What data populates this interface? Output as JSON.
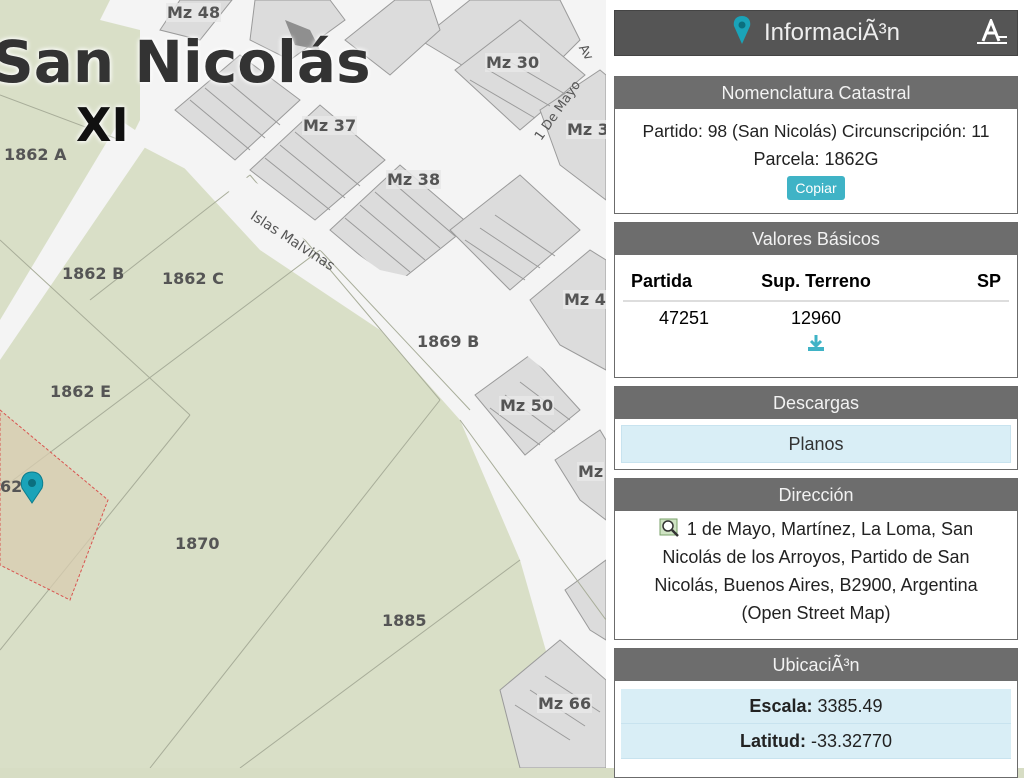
{
  "map": {
    "city_label": "San Nicolás",
    "district_label": "XI",
    "parcels": [
      "1862 A",
      "1862 B",
      "1862 C",
      "1862 E",
      "1869 B",
      "1870",
      "1885",
      "62"
    ],
    "blocks": [
      "Mz 48",
      "Mz 30",
      "Mz 37",
      "Mz 38",
      "Mz 3",
      "Mz 4",
      "Mz 50",
      "Mz",
      "Mz 66"
    ],
    "streets": [
      "Islas Malvinas",
      "1 De Mayo",
      "Av"
    ]
  },
  "panel": {
    "title": "InformaciÃ³n",
    "nomenclatura": {
      "header": "Nomenclatura Catastral",
      "line1": "Partido: 98 (San Nicolás) Circunscripción: 11",
      "line2": "Parcela: 1862G",
      "copy_label": "Copiar"
    },
    "valores": {
      "header": "Valores Básicos",
      "columns": [
        "Partida",
        "Sup. Terreno",
        "SP"
      ],
      "rows": [
        [
          "47251",
          "12960",
          ""
        ]
      ]
    },
    "descargas": {
      "header": "Descargas",
      "item": "Planos"
    },
    "direccion": {
      "header": "Dirección",
      "text": "1 de Mayo, Martínez, La Loma, San Nicolás de los Arroyos, Partido de San Nicolás, Buenos Aires, B2900, Argentina (Open Street Map)"
    },
    "ubicacion": {
      "header": "UbicaciÃ³n",
      "escala_label": "Escala:",
      "escala_value": "3385.49",
      "latitud_label": "Latitud:",
      "latitud_value": "-33.32770"
    }
  },
  "colors": {
    "parcel_green": "#d9dfc7",
    "block_gray": "#dcdcdc",
    "street_white": "#f4f4f4",
    "header_gray": "#6d6d6d",
    "accent_teal": "#3fb3c6",
    "selected_parcel": "#d8ccb0",
    "selection_border": "#d9534f"
  }
}
